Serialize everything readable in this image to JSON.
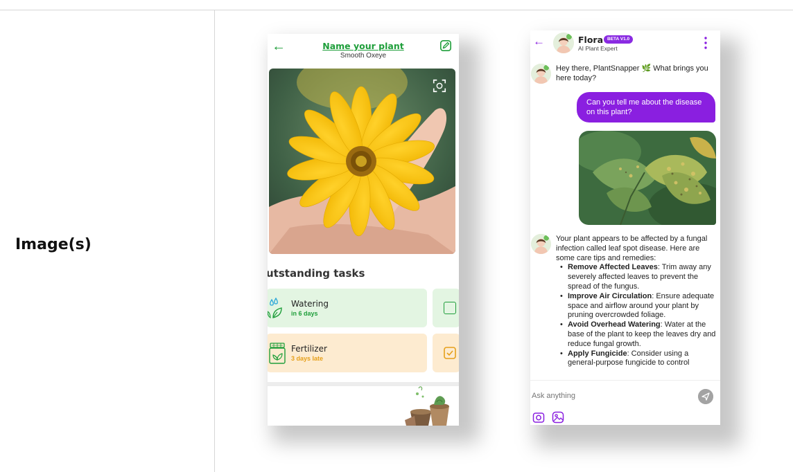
{
  "row_label": "Image(s)",
  "plant_screen": {
    "title": "Name your plant",
    "subtitle": "Smooth Oxeye",
    "tasks_heading": "utstanding tasks",
    "tasks": [
      {
        "name": "Watering",
        "due": "in 6 days",
        "due_color": "#1e9e3a",
        "card_color": "#e3f5e2"
      },
      {
        "name": "Fertilizer",
        "due": "3 days late",
        "due_color": "#e6a01a",
        "card_color": "#fdebd0"
      }
    ],
    "accent": "#1e9e3a"
  },
  "chat_screen": {
    "assistant_name": "Flora",
    "badge": "BETA V1.0",
    "assistant_role": "AI Plant Expert",
    "greeting": "Hey there, PlantSnapper 🌿 What brings you here today?",
    "user_message": "Can you tell me about the disease on this plant?",
    "reply_intro": "Your plant appears to be affected by a fungal infection called leaf spot disease. Here are some care tips and remedies:",
    "tips": [
      {
        "title": "Remove Affected Leaves",
        "text": ": Trim away any severely affected leaves to prevent the spread of the fungus."
      },
      {
        "title": "Improve Air Circulation",
        "text": ": Ensure adequate space and airflow around your plant by pruning overcrowded foliage."
      },
      {
        "title": "Avoid Overhead Watering",
        "text": ": Water at the base of the plant to keep the leaves dry and reduce fungal growth."
      },
      {
        "title": "Apply Fungicide",
        "text": ": Consider using a general-purpose fungicide to control"
      }
    ],
    "input_placeholder": "Ask anything",
    "accent": "#8a1fe0"
  }
}
